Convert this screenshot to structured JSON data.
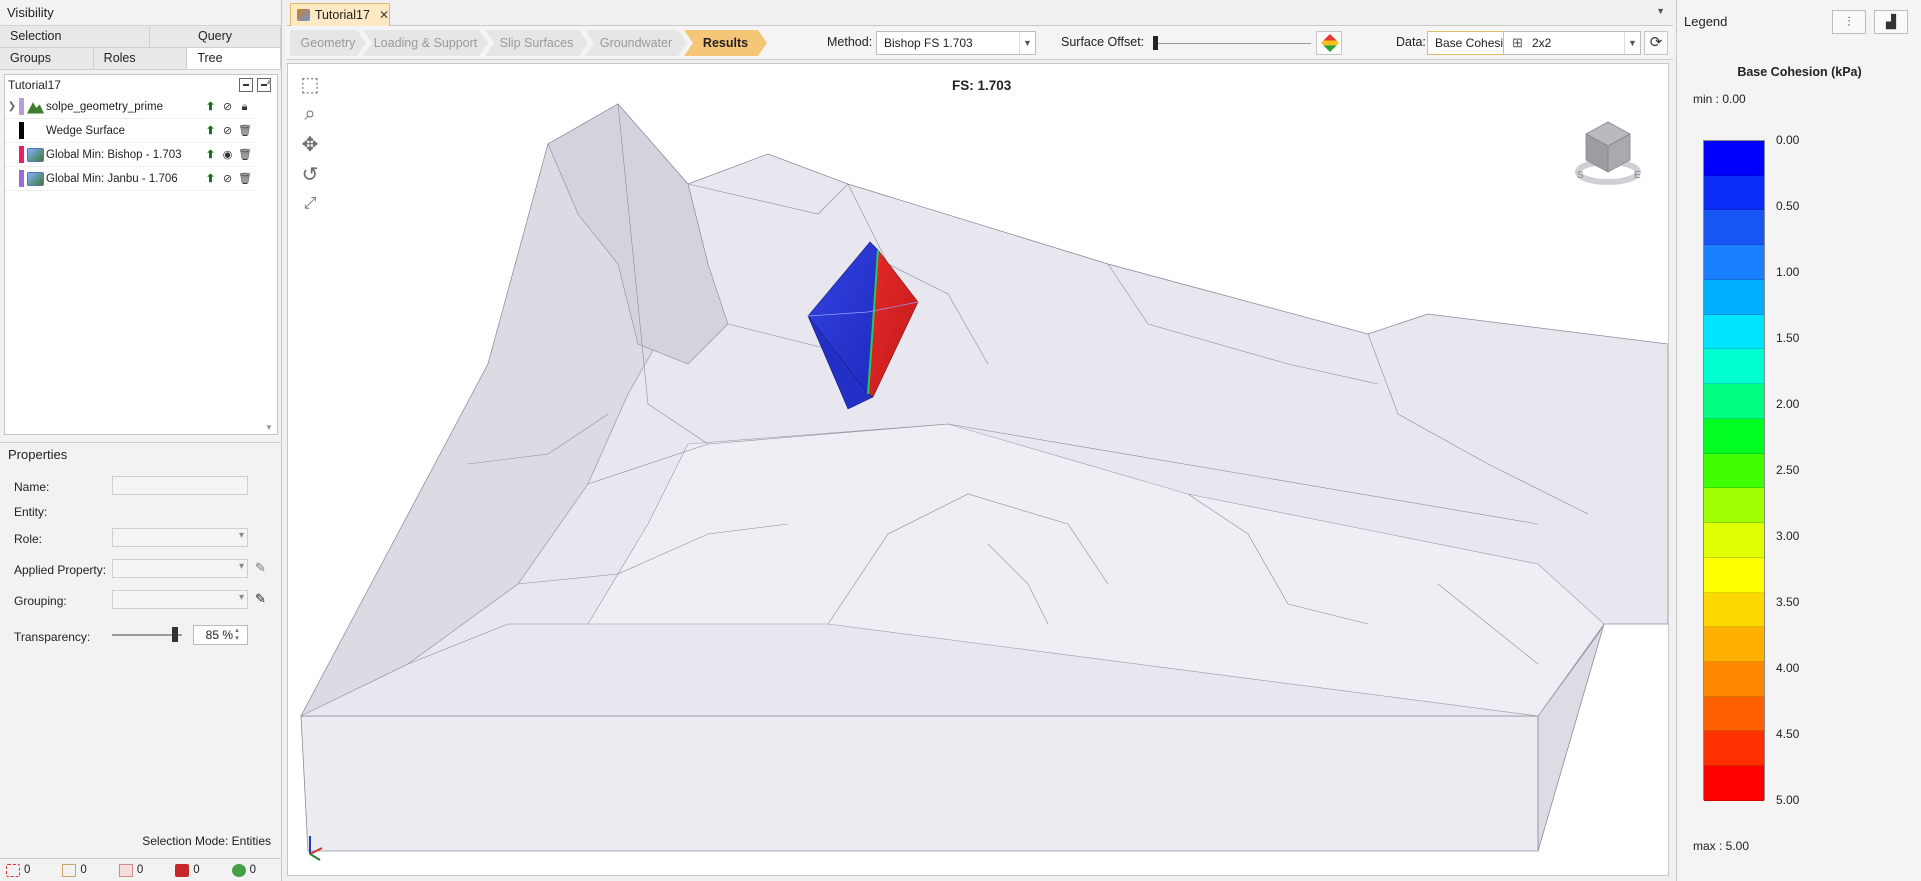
{
  "left_panel": {
    "visibility_title": "Visibility",
    "tabs_row1": [
      "Selection",
      "Query"
    ],
    "tabs_row2": [
      "Groups",
      "Roles",
      "Tree"
    ],
    "tree": {
      "root": "Tutorial17",
      "items": [
        {
          "label": "solpe_geometry_prime",
          "color": "#b39ddb"
        },
        {
          "label": "Wedge Surface",
          "color": "#000000"
        },
        {
          "label": "Global Min: Bishop  -  1.703",
          "color": "#e91e63"
        },
        {
          "label": "Global Min: Janbu  -  1.706",
          "color": "#9c6ade"
        }
      ]
    },
    "properties": {
      "title": "Properties",
      "name_label": "Name:",
      "entity_label": "Entity:",
      "role_label": "Role:",
      "applied_label": "Applied Property:",
      "grouping_label": "Grouping:",
      "transparency_label": "Transparency:",
      "transparency_value": "85 %"
    },
    "selection_mode": "Selection Mode: Entities",
    "status_counts": [
      "0",
      "0",
      "0",
      "0",
      "0"
    ]
  },
  "document": {
    "tab_title": "Tutorial17",
    "workflow": [
      "Geometry",
      "Loading & Support",
      "Slip Surfaces",
      "Groundwater",
      "Results"
    ],
    "active_step": "Results",
    "method_label": "Method:",
    "method_value": "Bishop FS    1.703",
    "surface_offset_label": "Surface Offset:",
    "data_label": "Data:",
    "data_value": "Base Cohesic",
    "layout_value": "2x2",
    "fs_text": "FS: 1.703"
  },
  "legend": {
    "title": "Legend",
    "quantity": "Base Cohesion (kPa)",
    "min_label": "min :  0.00",
    "max_label": "max :  5.00",
    "ticks": [
      "0.00",
      "0.50",
      "1.00",
      "1.50",
      "2.00",
      "2.50",
      "3.00",
      "3.50",
      "4.00",
      "4.50",
      "5.00"
    ],
    "colors": [
      "#0000ff",
      "#0a2cf6",
      "#1656f2",
      "#1a80ff",
      "#00b0ff",
      "#00e5ff",
      "#00ffd0",
      "#00ff80",
      "#00ff20",
      "#40ff00",
      "#a0ff00",
      "#e0ff00",
      "#ffff00",
      "#ffd800",
      "#ffb000",
      "#ff8800",
      "#ff6000",
      "#ff3000",
      "#ff0000"
    ]
  }
}
